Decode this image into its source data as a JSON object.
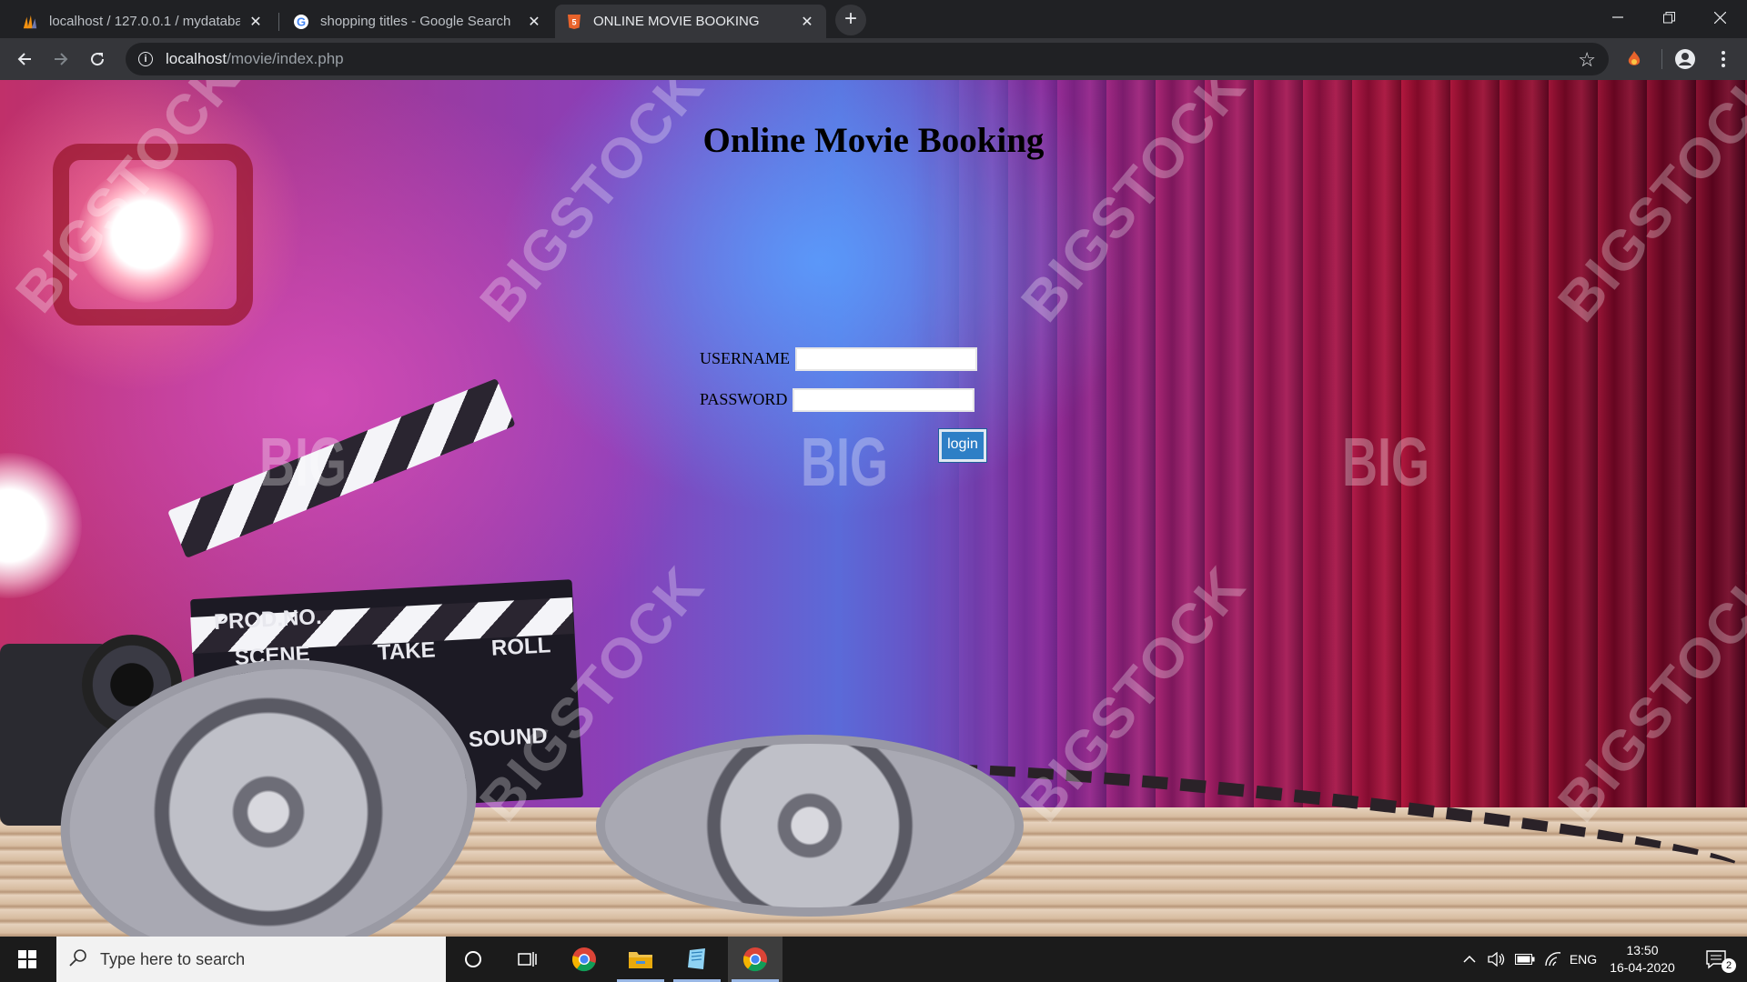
{
  "browser": {
    "tabs": [
      {
        "title": "localhost / 127.0.0.1 / mydatabas",
        "favicon": "phpmyadmin-icon",
        "active": false
      },
      {
        "title": "shopping titles - Google Search",
        "favicon": "google-icon",
        "active": false
      },
      {
        "title": "ONLINE MOVIE BOOKING",
        "favicon": "html5-icon",
        "active": true
      }
    ],
    "new_tab": "+",
    "url_host": "localhost",
    "url_path": "/movie/index.php"
  },
  "page": {
    "title": "Online Movie Booking",
    "username_label": "USERNAME",
    "password_label": "PASSWORD",
    "username_value": "",
    "password_value": "",
    "login_label": "login",
    "background": {
      "watermark_text": "BIGSTOCK",
      "watermark_short": "BIG",
      "clapper": {
        "prod": "PROD.NO.",
        "scene": "SCENE",
        "take": "TAKE",
        "roll": "ROLL",
        "sound": "SOUND"
      }
    }
  },
  "taskbar": {
    "search_placeholder": "Type here to search",
    "language": "ENG",
    "time": "13:50",
    "date": "16-04-2020",
    "notification_count": "2"
  },
  "colors": {
    "button_blue": "#2e7fc6",
    "chrome_dark": "#202124",
    "chrome_toolbar": "#35363a"
  }
}
